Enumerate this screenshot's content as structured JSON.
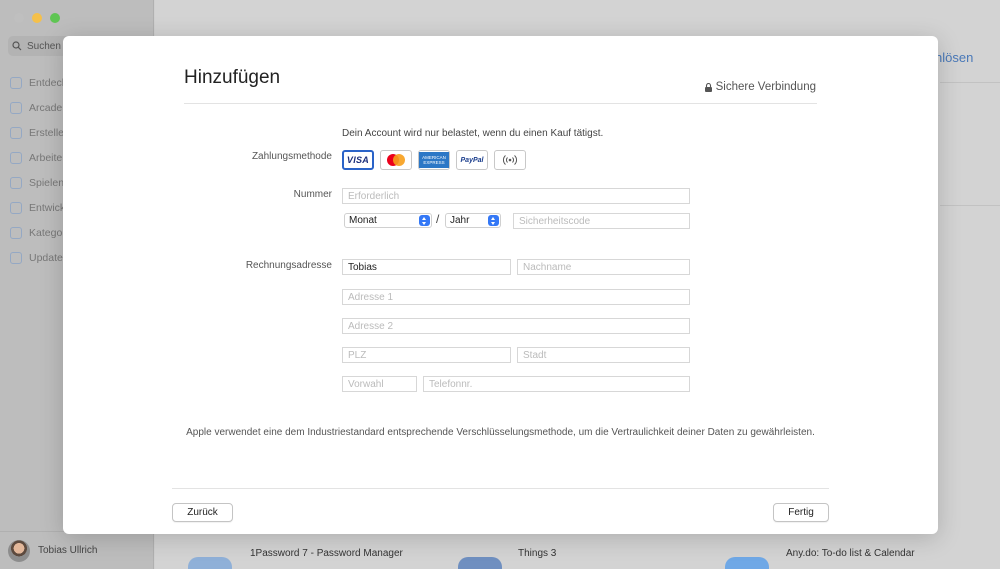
{
  "sidebar": {
    "search_label": "Suchen",
    "items": [
      {
        "label": "Entdecken"
      },
      {
        "label": "Arcade"
      },
      {
        "label": "Erstellen"
      },
      {
        "label": "Arbeiten"
      },
      {
        "label": "Spielen"
      },
      {
        "label": "Entwickeln"
      },
      {
        "label": "Kategorien"
      },
      {
        "label": "Updates"
      }
    ],
    "user_name": "Tobias Ullrich"
  },
  "background": {
    "redeem_partial": "nlösen",
    "apps": [
      {
        "name": "1Password 7 - Password Manager"
      },
      {
        "name": "Things 3"
      },
      {
        "name": "Any.do: To-do list & Calendar"
      }
    ]
  },
  "modal": {
    "title": "Hinzufügen",
    "secure_label": "Sichere Verbindung",
    "notice": "Dein Account wird nur belastet, wenn du einen Kauf tätigst.",
    "payment_label": "Zahlungsmethode",
    "cards": {
      "visa": "VISA",
      "amex_line1": "AMERICAN",
      "amex_line2": "EXPRESS",
      "paypal": "PayPal"
    },
    "number_label": "Nummer",
    "number_placeholder": "Erforderlich",
    "month_value": "Monat",
    "year_value": "Jahr",
    "security_placeholder": "Sicherheitscode",
    "address_label": "Rechnungsadresse",
    "first_name_value": "Tobias",
    "last_name_placeholder": "Nachname",
    "address1_placeholder": "Adresse 1",
    "address2_placeholder": "Adresse 2",
    "zip_placeholder": "PLZ",
    "city_placeholder": "Stadt",
    "area_code_placeholder": "Vorwahl",
    "phone_placeholder": "Telefonnr.",
    "footnote": "Apple verwendet eine dem Industriestandard entsprechende Verschlüsselungsmethode, um die Vertraulichkeit deiner Daten zu gewährleisten.",
    "back_button": "Zurück",
    "done_button": "Fertig"
  }
}
